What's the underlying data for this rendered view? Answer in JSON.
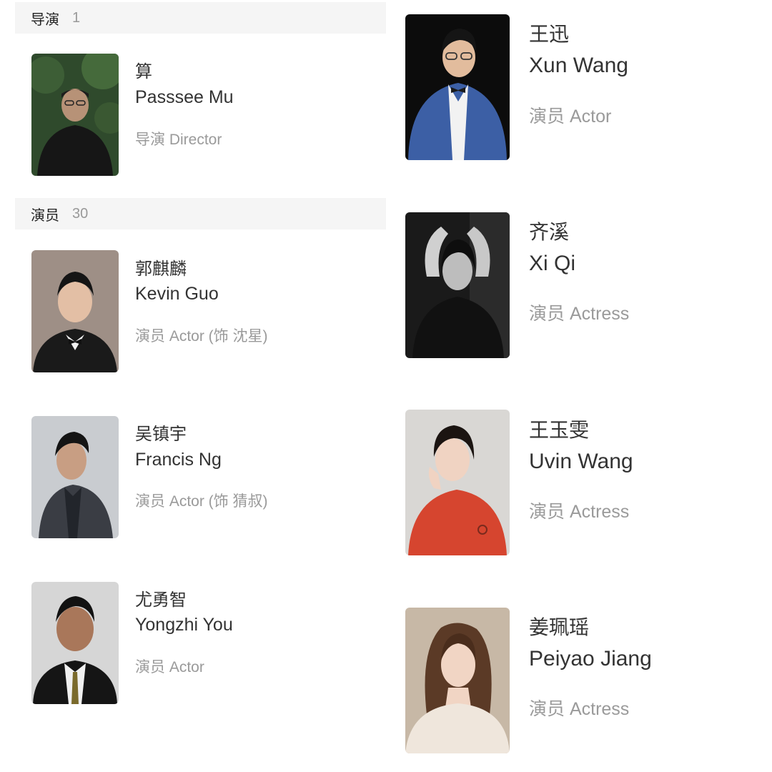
{
  "sections": {
    "director": {
      "title": "导演",
      "count": "1"
    },
    "cast": {
      "title": "演员",
      "count": "30"
    }
  },
  "people": [
    {
      "id": "mu",
      "cn": "算",
      "en": "Passsee Mu",
      "role": "导演 Director",
      "photo": "director-portrait"
    },
    {
      "id": "guo",
      "cn": "郭麒麟",
      "en": "Kevin Guo",
      "role": "演员 Actor (饰 沈星)",
      "photo": "actor-portrait"
    },
    {
      "id": "ng",
      "cn": "吴镇宇",
      "en": "Francis Ng",
      "role": "演员 Actor (饰 猜叔)",
      "photo": "actor-portrait"
    },
    {
      "id": "you",
      "cn": "尤勇智",
      "en": "Yongzhi You",
      "role": "演员 Actor",
      "photo": "actor-portrait"
    },
    {
      "id": "wang_xun",
      "cn": "王迅",
      "en": "Xun Wang",
      "role": "演员 Actor",
      "photo": "actor-portrait"
    },
    {
      "id": "qi",
      "cn": "齐溪",
      "en": "Xi Qi",
      "role": "演员 Actress",
      "photo": "actress-portrait"
    },
    {
      "id": "wang_yuwen",
      "cn": "王玉雯",
      "en": "Uvin Wang",
      "role": "演员 Actress",
      "photo": "actress-portrait"
    },
    {
      "id": "jiang",
      "cn": "姜珮瑶",
      "en": "Peiyao Jiang",
      "role": "演员 Actress",
      "photo": "actress-portrait"
    }
  ]
}
